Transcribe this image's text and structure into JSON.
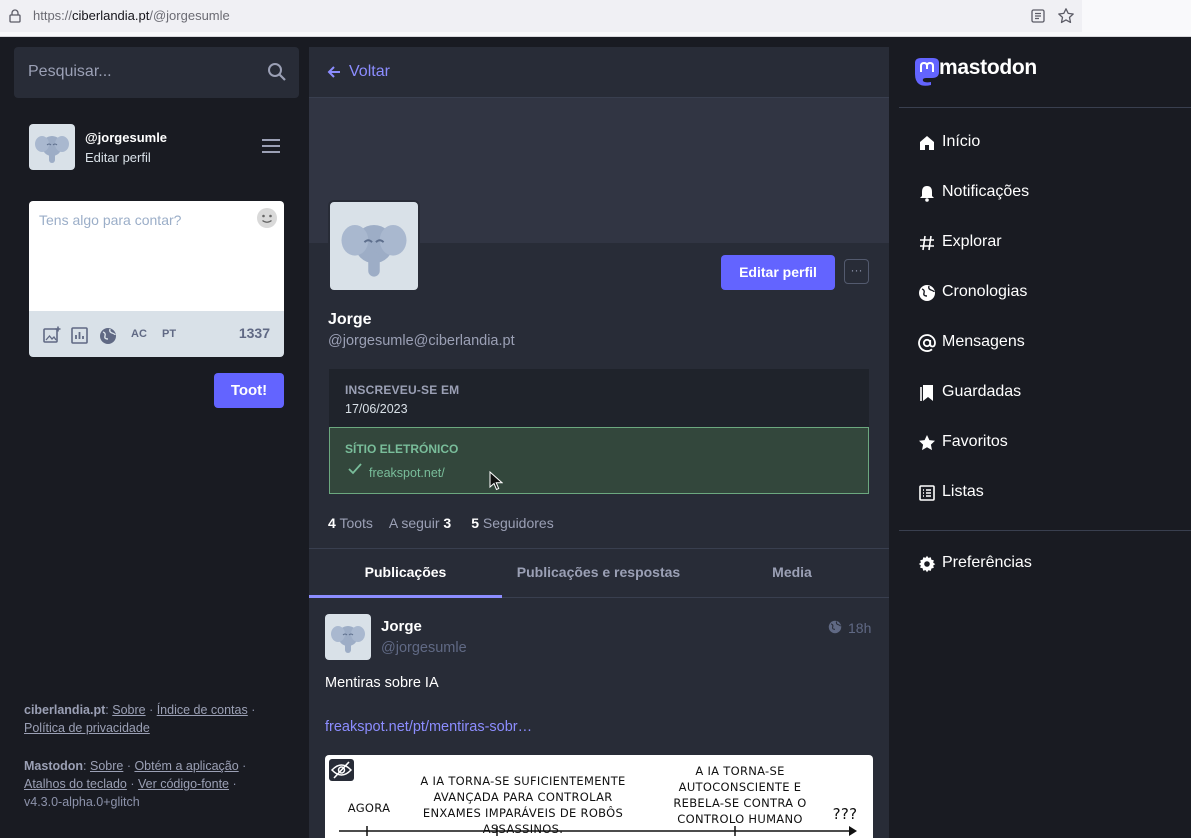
{
  "browser": {
    "url_prefix": "https://",
    "url_host": "ciberlandia.pt",
    "url_path": "/@jorgesumle"
  },
  "search": {
    "placeholder": "Pesquisar..."
  },
  "me": {
    "handle": "@jorgesumle",
    "edit_label": "Editar perfil"
  },
  "compose": {
    "placeholder": "Tens algo para contar?",
    "tools": [
      "AC",
      "PT"
    ],
    "char_count": "1337",
    "submit_label": "Toot!"
  },
  "footer": {
    "server": "ciberlandia.pt",
    "server_links": [
      "Sobre",
      "Índice de contas",
      "Política de privacidade"
    ],
    "mastodon": "Mastodon",
    "mastodon_links": [
      "Sobre",
      "Obtém a aplicação",
      "Atalhos do teclado",
      "Ver código-fonte"
    ],
    "version": "v4.3.0-alpha.0+glitch"
  },
  "profile": {
    "back_label": "Voltar",
    "edit_button": "Editar perfil",
    "more_button": "···",
    "name": "Jorge",
    "acct": "@jorgesumle@ciberlandia.pt",
    "joined_label": "INSCREVEU-SE EM",
    "joined_value": "17/06/2023",
    "website_label": "SÍTIO ELETRÓNICO",
    "website_value": "freakspot.net/",
    "counts": {
      "toots_n": "4",
      "toots_label": "Toots",
      "following_label": "A seguir",
      "following_n": "3",
      "followers_n": "5",
      "followers_label": "Seguidores"
    },
    "tabs": [
      "Publicações",
      "Publicações e respostas",
      "Media"
    ]
  },
  "post": {
    "name": "Jorge",
    "acct": "@jorgesumle",
    "time": "18h",
    "text": "Mentiras sobre IA",
    "link": "freakspot.net/pt/mentiras-sobr…",
    "comic": {
      "c1": "AGORA",
      "c2": "A IA TORNA-SE SUFICIENTEMENTE AVANÇADA PARA CONTROLAR ENXAMES IMPARÁVEIS DE ROBÔS ASSASSINOS.",
      "c3": "A IA TORNA-SE AUTOCONSCIENTE E REBELA-SE CONTRA O CONTROLO HUMANO",
      "c4": "???"
    }
  },
  "logo": {
    "word": "mastodon"
  },
  "nav": [
    {
      "label": "Início",
      "icon": "home-icon"
    },
    {
      "label": "Notificações",
      "icon": "bell-icon"
    },
    {
      "label": "Explorar",
      "icon": "hashtag-icon"
    },
    {
      "label": "Cronologias",
      "icon": "globe-icon"
    },
    {
      "label": "Mensagens",
      "icon": "at-icon"
    },
    {
      "label": "Guardadas",
      "icon": "bookmark-icon"
    },
    {
      "label": "Favoritos",
      "icon": "star-icon"
    },
    {
      "label": "Listas",
      "icon": "list-icon"
    },
    {
      "label": "Preferências",
      "icon": "gear-icon"
    }
  ],
  "colors": {
    "accent": "#6364ff",
    "link": "#8c8dff",
    "verified": "#79bd9a",
    "bg": "#191b22",
    "panel": "#282c37"
  }
}
